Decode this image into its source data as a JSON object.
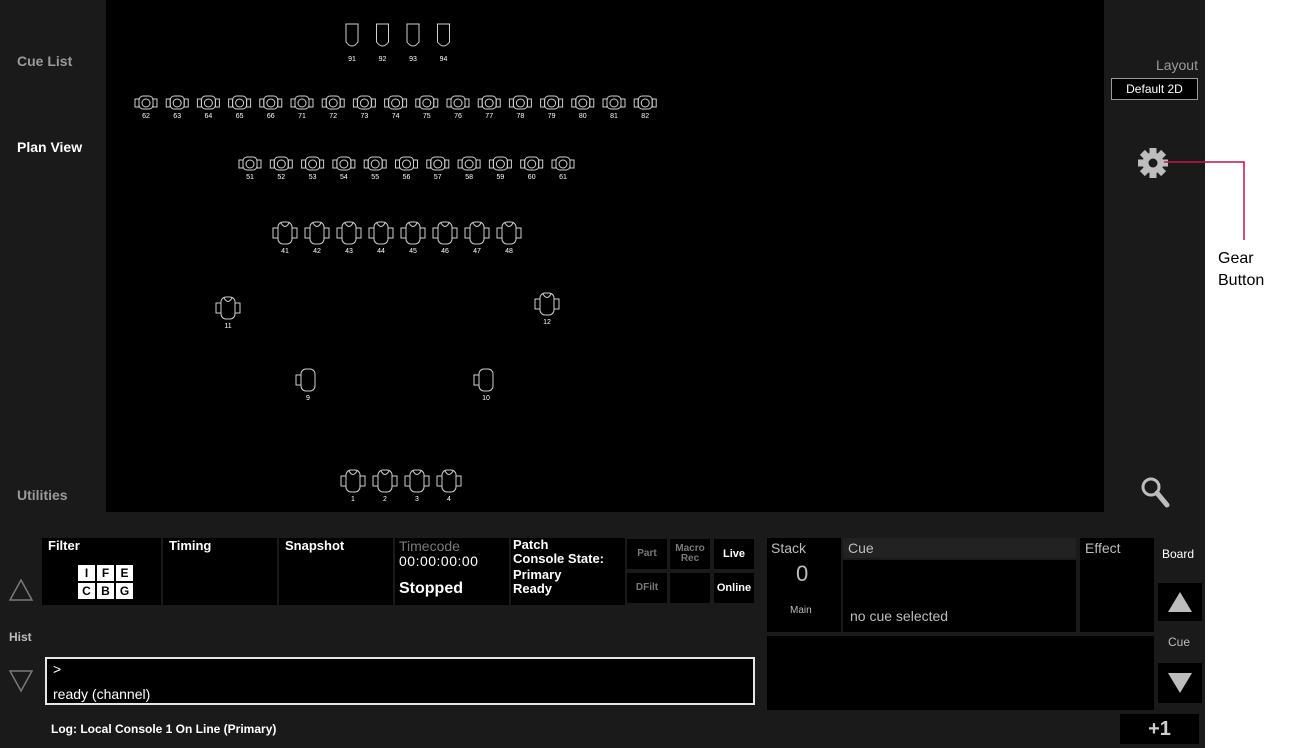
{
  "sidebar": {
    "items": [
      {
        "label": "Cue List"
      },
      {
        "label": "Plan View"
      },
      {
        "label": "Utilities"
      }
    ]
  },
  "layout": {
    "label": "Layout",
    "value": "Default 2D"
  },
  "icons": {
    "settings": "gear-icon",
    "search": "magnifier-icon"
  },
  "plan": {
    "rows": {
      "par_top": [
        "91",
        "92",
        "93",
        "94"
      ],
      "row_62": [
        "62",
        "63",
        "64",
        "65",
        "66",
        "71",
        "72",
        "73",
        "74",
        "75",
        "76",
        "77",
        "78",
        "79",
        "80",
        "81",
        "82"
      ],
      "row_51": [
        "51",
        "52",
        "53",
        "54",
        "55",
        "56",
        "57",
        "58",
        "59",
        "60",
        "61"
      ],
      "row_41": [
        "41",
        "42",
        "43",
        "44",
        "45",
        "46",
        "47",
        "48"
      ],
      "singles": [
        "11",
        "12",
        "9",
        "10"
      ],
      "row_1": [
        "1",
        "2",
        "3",
        "4"
      ]
    }
  },
  "bottom": {
    "tiles": {
      "filter": "Filter",
      "timing": "Timing",
      "snapshot": "Snapshot",
      "timecode": "Timecode",
      "timecode_value": "00:00:00:00",
      "timecode_state": "Stopped",
      "patch": "Patch",
      "console_state": "Console State:",
      "console_state_value": "Primary",
      "console_state_value2": "Ready"
    },
    "filter_keys": [
      "I",
      "F",
      "E",
      "C",
      "B",
      "G"
    ],
    "buttons": {
      "part": "Part",
      "macro": "Macro",
      "macro2": "Rec",
      "live": "Live",
      "dfilt": "DFilt",
      "online": "Online"
    },
    "hist": "Hist",
    "command_prompt": ">",
    "command_status": "ready (channel)",
    "log": "Log: Local Console 1 On Line (Primary)"
  },
  "cue_panel": {
    "stack_label": "Stack",
    "stack_value": "0",
    "stack_name": "Main",
    "cue_label": "Cue",
    "cue_text": "no cue selected",
    "effect_label": "Effect",
    "board_label": "Board",
    "cue_nav_label": "Cue",
    "plus_one": "+1"
  },
  "annotation": {
    "line1": "Gear",
    "line2": "Button",
    "color": "#c0154b"
  }
}
